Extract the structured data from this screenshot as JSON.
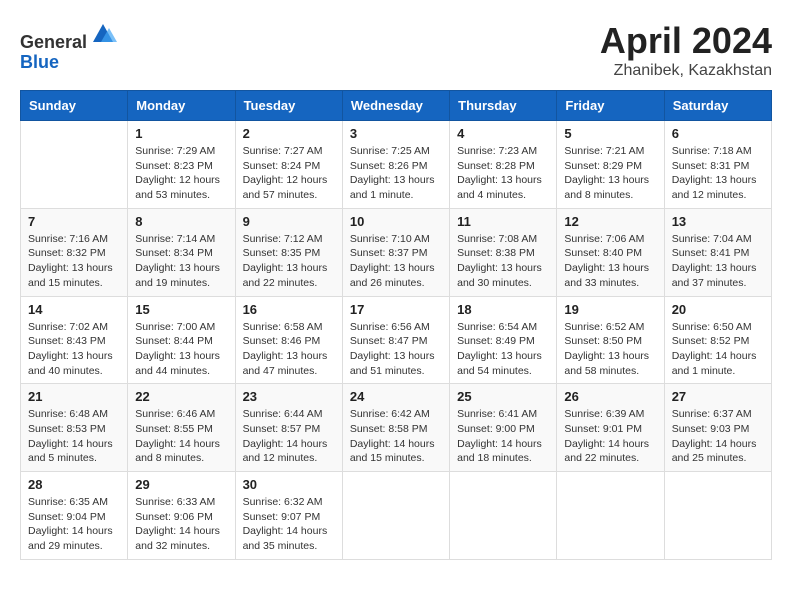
{
  "header": {
    "logo_line1": "General",
    "logo_line2": "Blue",
    "title": "April 2024",
    "subtitle": "Zhanibek, Kazakhstan"
  },
  "columns": [
    "Sunday",
    "Monday",
    "Tuesday",
    "Wednesday",
    "Thursday",
    "Friday",
    "Saturday"
  ],
  "weeks": [
    [
      {
        "day": "",
        "info": ""
      },
      {
        "day": "1",
        "info": "Sunrise: 7:29 AM\nSunset: 8:23 PM\nDaylight: 12 hours\nand 53 minutes."
      },
      {
        "day": "2",
        "info": "Sunrise: 7:27 AM\nSunset: 8:24 PM\nDaylight: 12 hours\nand 57 minutes."
      },
      {
        "day": "3",
        "info": "Sunrise: 7:25 AM\nSunset: 8:26 PM\nDaylight: 13 hours\nand 1 minute."
      },
      {
        "day": "4",
        "info": "Sunrise: 7:23 AM\nSunset: 8:28 PM\nDaylight: 13 hours\nand 4 minutes."
      },
      {
        "day": "5",
        "info": "Sunrise: 7:21 AM\nSunset: 8:29 PM\nDaylight: 13 hours\nand 8 minutes."
      },
      {
        "day": "6",
        "info": "Sunrise: 7:18 AM\nSunset: 8:31 PM\nDaylight: 13 hours\nand 12 minutes."
      }
    ],
    [
      {
        "day": "7",
        "info": "Sunrise: 7:16 AM\nSunset: 8:32 PM\nDaylight: 13 hours\nand 15 minutes."
      },
      {
        "day": "8",
        "info": "Sunrise: 7:14 AM\nSunset: 8:34 PM\nDaylight: 13 hours\nand 19 minutes."
      },
      {
        "day": "9",
        "info": "Sunrise: 7:12 AM\nSunset: 8:35 PM\nDaylight: 13 hours\nand 22 minutes."
      },
      {
        "day": "10",
        "info": "Sunrise: 7:10 AM\nSunset: 8:37 PM\nDaylight: 13 hours\nand 26 minutes."
      },
      {
        "day": "11",
        "info": "Sunrise: 7:08 AM\nSunset: 8:38 PM\nDaylight: 13 hours\nand 30 minutes."
      },
      {
        "day": "12",
        "info": "Sunrise: 7:06 AM\nSunset: 8:40 PM\nDaylight: 13 hours\nand 33 minutes."
      },
      {
        "day": "13",
        "info": "Sunrise: 7:04 AM\nSunset: 8:41 PM\nDaylight: 13 hours\nand 37 minutes."
      }
    ],
    [
      {
        "day": "14",
        "info": "Sunrise: 7:02 AM\nSunset: 8:43 PM\nDaylight: 13 hours\nand 40 minutes."
      },
      {
        "day": "15",
        "info": "Sunrise: 7:00 AM\nSunset: 8:44 PM\nDaylight: 13 hours\nand 44 minutes."
      },
      {
        "day": "16",
        "info": "Sunrise: 6:58 AM\nSunset: 8:46 PM\nDaylight: 13 hours\nand 47 minutes."
      },
      {
        "day": "17",
        "info": "Sunrise: 6:56 AM\nSunset: 8:47 PM\nDaylight: 13 hours\nand 51 minutes."
      },
      {
        "day": "18",
        "info": "Sunrise: 6:54 AM\nSunset: 8:49 PM\nDaylight: 13 hours\nand 54 minutes."
      },
      {
        "day": "19",
        "info": "Sunrise: 6:52 AM\nSunset: 8:50 PM\nDaylight: 13 hours\nand 58 minutes."
      },
      {
        "day": "20",
        "info": "Sunrise: 6:50 AM\nSunset: 8:52 PM\nDaylight: 14 hours\nand 1 minute."
      }
    ],
    [
      {
        "day": "21",
        "info": "Sunrise: 6:48 AM\nSunset: 8:53 PM\nDaylight: 14 hours\nand 5 minutes."
      },
      {
        "day": "22",
        "info": "Sunrise: 6:46 AM\nSunset: 8:55 PM\nDaylight: 14 hours\nand 8 minutes."
      },
      {
        "day": "23",
        "info": "Sunrise: 6:44 AM\nSunset: 8:57 PM\nDaylight: 14 hours\nand 12 minutes."
      },
      {
        "day": "24",
        "info": "Sunrise: 6:42 AM\nSunset: 8:58 PM\nDaylight: 14 hours\nand 15 minutes."
      },
      {
        "day": "25",
        "info": "Sunrise: 6:41 AM\nSunset: 9:00 PM\nDaylight: 14 hours\nand 18 minutes."
      },
      {
        "day": "26",
        "info": "Sunrise: 6:39 AM\nSunset: 9:01 PM\nDaylight: 14 hours\nand 22 minutes."
      },
      {
        "day": "27",
        "info": "Sunrise: 6:37 AM\nSunset: 9:03 PM\nDaylight: 14 hours\nand 25 minutes."
      }
    ],
    [
      {
        "day": "28",
        "info": "Sunrise: 6:35 AM\nSunset: 9:04 PM\nDaylight: 14 hours\nand 29 minutes."
      },
      {
        "day": "29",
        "info": "Sunrise: 6:33 AM\nSunset: 9:06 PM\nDaylight: 14 hours\nand 32 minutes."
      },
      {
        "day": "30",
        "info": "Sunrise: 6:32 AM\nSunset: 9:07 PM\nDaylight: 14 hours\nand 35 minutes."
      },
      {
        "day": "",
        "info": ""
      },
      {
        "day": "",
        "info": ""
      },
      {
        "day": "",
        "info": ""
      },
      {
        "day": "",
        "info": ""
      }
    ]
  ]
}
